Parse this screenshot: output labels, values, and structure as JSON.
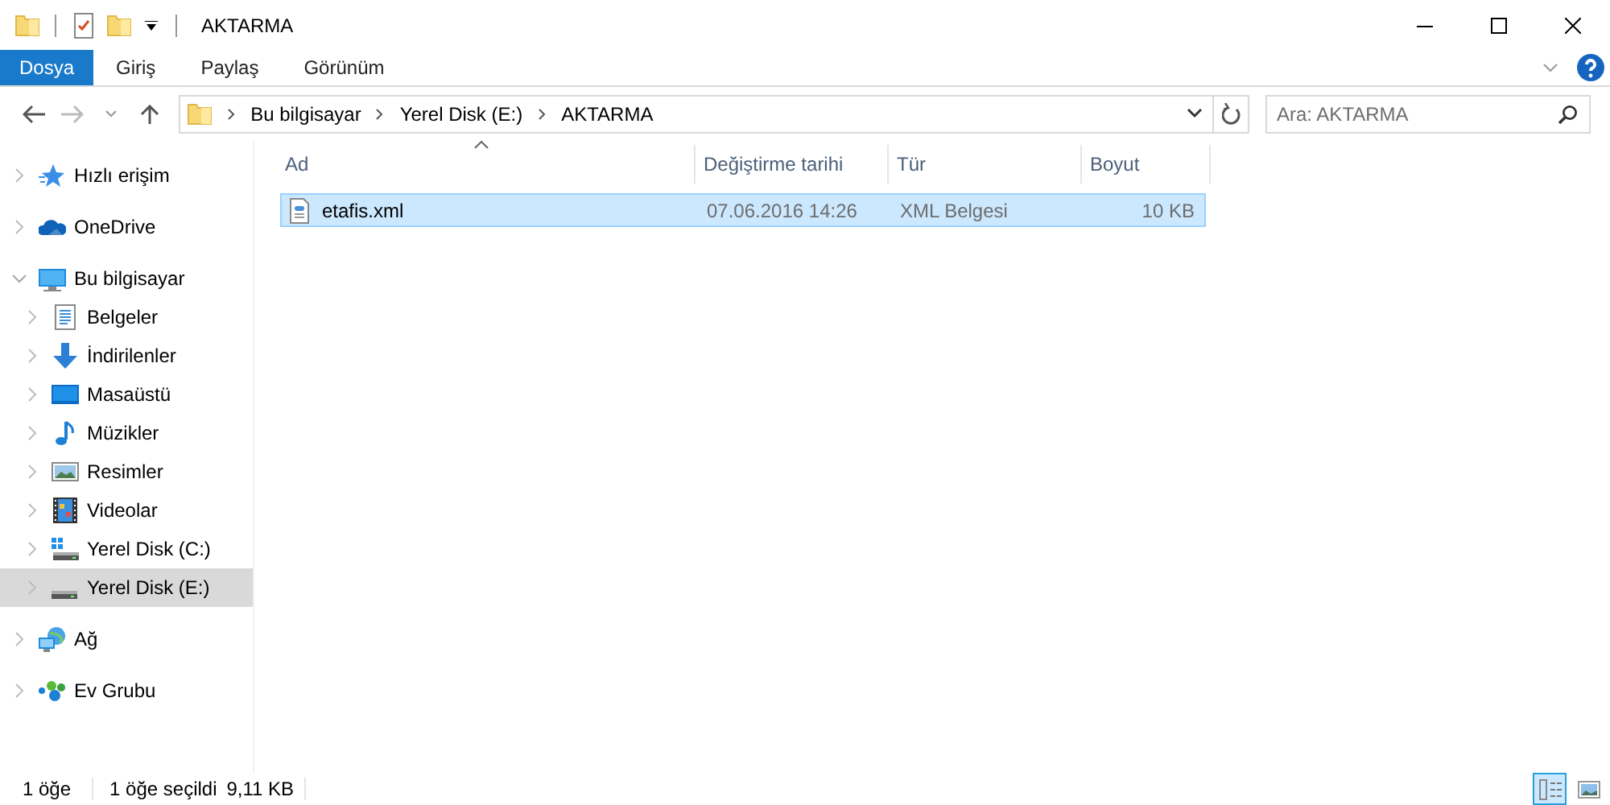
{
  "window": {
    "title": "AKTARMA"
  },
  "ribbon": {
    "tabs": [
      {
        "label": "Dosya",
        "kind": "file"
      },
      {
        "label": "Giriş",
        "kind": "tab"
      },
      {
        "label": "Paylaş",
        "kind": "tab"
      },
      {
        "label": "Görünüm",
        "kind": "tab"
      }
    ]
  },
  "address_bar": {
    "path": [
      "Bu bilgisayar",
      "Yerel Disk (E:)",
      "AKTARMA"
    ]
  },
  "search": {
    "placeholder": "Ara: AKTARMA"
  },
  "navigation": {
    "items": [
      {
        "label": "Hızlı erişim",
        "kind": "star",
        "expanded": false,
        "selected": false
      },
      {
        "label": "OneDrive",
        "kind": "cloud",
        "expanded": false,
        "selected": false
      },
      {
        "label": "Bu bilgisayar",
        "kind": "pc",
        "expanded": true,
        "selected": false,
        "children": [
          {
            "label": "Belgeler",
            "kind": "docs",
            "expanded": false,
            "selected": false
          },
          {
            "label": "İndirilenler",
            "kind": "download",
            "expanded": false,
            "selected": false
          },
          {
            "label": "Masaüstü",
            "kind": "desktop",
            "expanded": false,
            "selected": false
          },
          {
            "label": "Müzikler",
            "kind": "music",
            "expanded": false,
            "selected": false
          },
          {
            "label": "Resimler",
            "kind": "pictures",
            "expanded": false,
            "selected": false
          },
          {
            "label": "Videolar",
            "kind": "videos",
            "expanded": false,
            "selected": false
          },
          {
            "label": "Yerel Disk (C:)",
            "kind": "system-drive",
            "expanded": false,
            "selected": false
          },
          {
            "label": "Yerel Disk (E:)",
            "kind": "drive",
            "expanded": false,
            "selected": true
          }
        ]
      },
      {
        "label": "Ağ",
        "kind": "network",
        "expanded": false,
        "selected": false
      },
      {
        "label": "Ev Grubu",
        "kind": "homegroup",
        "expanded": false,
        "selected": false
      }
    ]
  },
  "file_list": {
    "columns": [
      {
        "label": "Ad",
        "sorted": true
      },
      {
        "label": "Değiştirme tarihi",
        "sorted": false
      },
      {
        "label": "Tür",
        "sorted": false
      },
      {
        "label": "Boyut",
        "sorted": false
      }
    ],
    "rows": [
      {
        "name": "etafis.xml",
        "modified": "07.06.2016 14:26",
        "type": "XML Belgesi",
        "size": "10 KB",
        "selected": true
      }
    ]
  },
  "status_bar": {
    "item_count": "1 öğe",
    "selection": "1 öğe seçildi",
    "selection_size": "9,11 KB"
  },
  "view_buttons": [
    {
      "kind": "details",
      "selected": true
    },
    {
      "kind": "large-icons",
      "selected": false
    }
  ]
}
